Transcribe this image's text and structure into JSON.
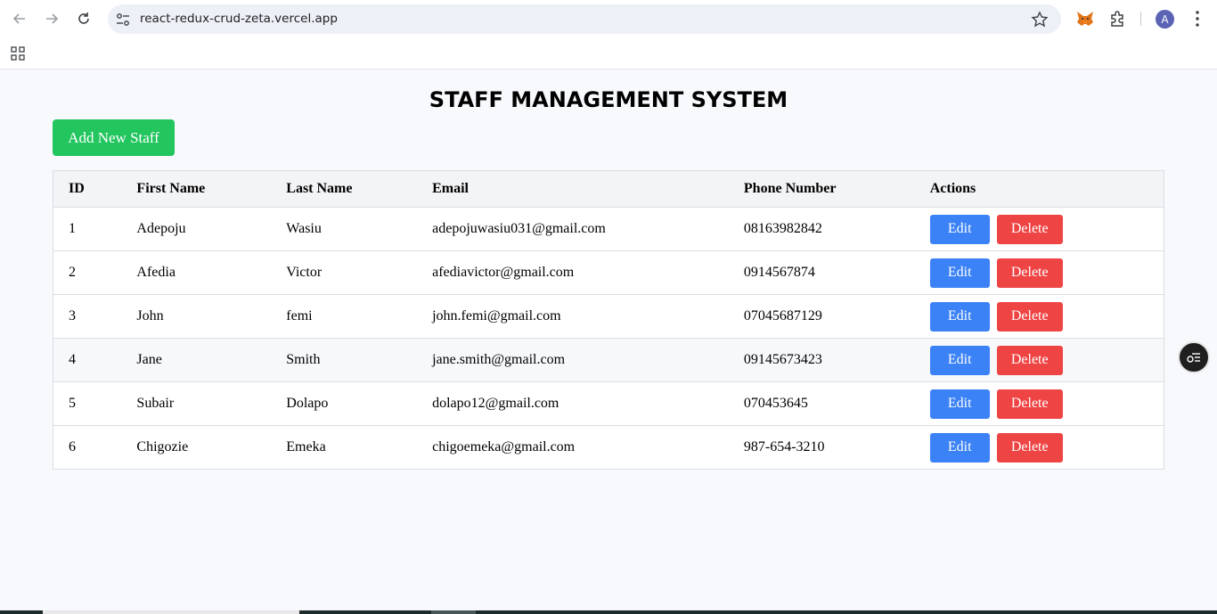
{
  "browser": {
    "url": "react-redux-crud-zeta.vercel.app",
    "avatar_letter": "A"
  },
  "page": {
    "title": "STAFF MANAGEMENT SYSTEM",
    "add_button_label": "Add New Staff"
  },
  "table": {
    "headers": {
      "id": "ID",
      "first_name": "First Name",
      "last_name": "Last Name",
      "email": "Email",
      "phone": "Phone Number",
      "actions": "Actions"
    },
    "edit_label": "Edit",
    "delete_label": "Delete",
    "rows": [
      {
        "id": "1",
        "first_name": "Adepoju",
        "last_name": "Wasiu",
        "email": "adepojuwasiu031@gmail.com",
        "phone": "08163982842"
      },
      {
        "id": "2",
        "first_name": "Afedia",
        "last_name": "Victor",
        "email": "afediavictor@gmail.com",
        "phone": "0914567874"
      },
      {
        "id": "3",
        "first_name": "John",
        "last_name": "femi",
        "email": "john.femi@gmail.com",
        "phone": "07045687129"
      },
      {
        "id": "4",
        "first_name": "Jane",
        "last_name": "Smith",
        "email": "jane.smith@gmail.com",
        "phone": "09145673423"
      },
      {
        "id": "5",
        "first_name": "Subair",
        "last_name": "Dolapo",
        "email": "dolapo12@gmail.com",
        "phone": "070453645"
      },
      {
        "id": "6",
        "first_name": "Chigozie",
        "last_name": "Emeka",
        "email": "chigoemeka@gmail.com",
        "phone": "987-654-3210"
      }
    ]
  },
  "colors": {
    "add_button": "#22c55e",
    "edit_button": "#3b82f6",
    "delete_button": "#ef4444"
  }
}
